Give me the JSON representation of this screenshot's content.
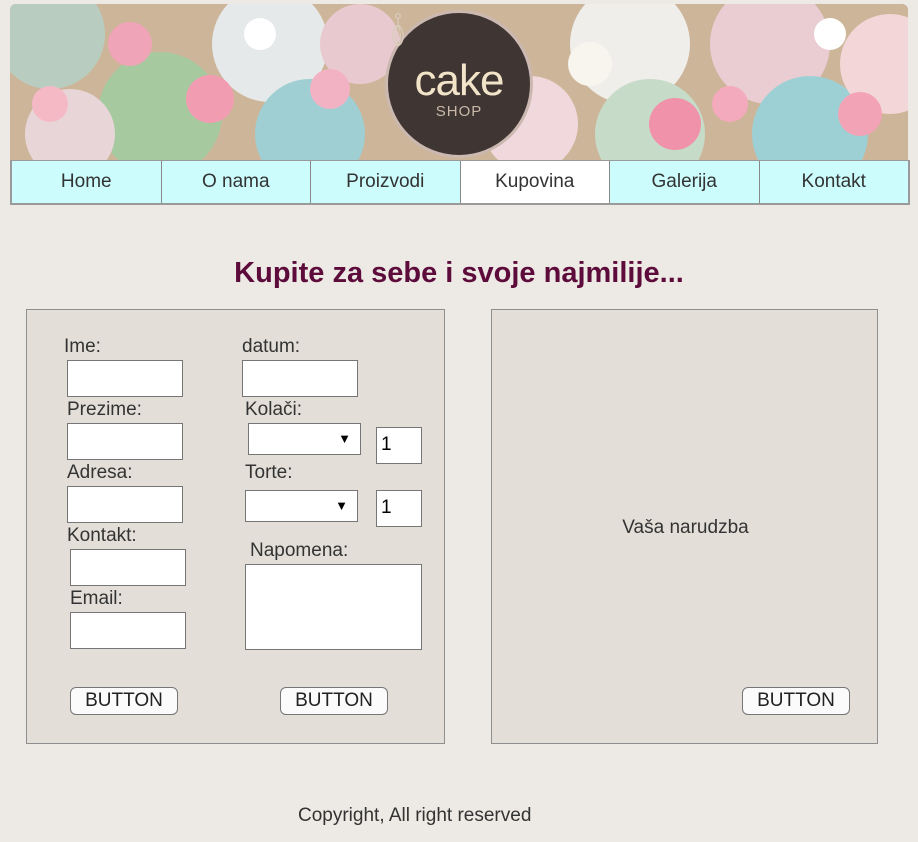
{
  "logo": {
    "word": "cake",
    "sub": "SHOP"
  },
  "nav": [
    {
      "label": "Home"
    },
    {
      "label": "O nama"
    },
    {
      "label": "Proizvodi"
    },
    {
      "label": "Kupovina"
    },
    {
      "label": "Galerija"
    },
    {
      "label": "Kontakt"
    }
  ],
  "page": {
    "title": "Kupite za sebe i svoje najmilije..."
  },
  "form": {
    "ime_label": "Ime:",
    "prezime_label": "Prezime:",
    "adresa_label": "Adresa:",
    "kontakt_label": "Kontakt:",
    "email_label": "Email:",
    "datum_label": "datum:",
    "kolaci_label": "Kolači:",
    "kolaci_qty": "1",
    "torte_label": "Torte:",
    "torte_qty": "1",
    "napomena_label": "Napomena:",
    "button1": "BUTTON",
    "button2": "BUTTON"
  },
  "order": {
    "text": "Vaša narudzba",
    "button": "BUTTON"
  },
  "footer": {
    "copyright": "Copyright, All right reserved"
  },
  "colors": {
    "nav_bg": "#ccfcfc",
    "title": "#5c0b3b",
    "page_bg": "#ede9e4",
    "panel_bg": "#e3dfd8"
  }
}
